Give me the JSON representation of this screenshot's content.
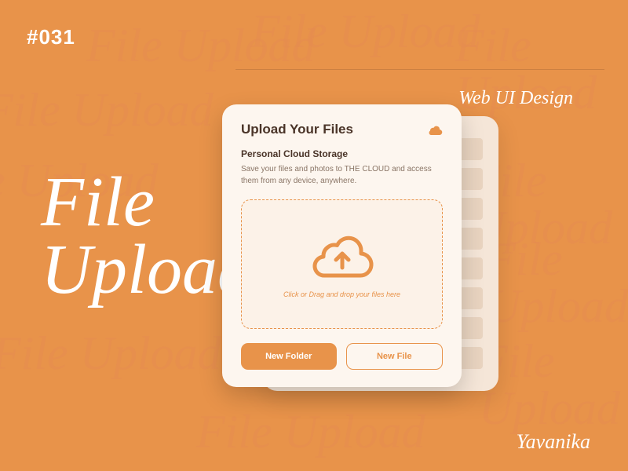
{
  "tag": "#031",
  "main_title_line1": "File",
  "main_title_line2": "Upload",
  "sub_label": "Web UI Design",
  "author": "Yavanika",
  "bg_word": "File Upload",
  "card": {
    "title": "Upload Your Files",
    "subtitle": "Personal Cloud Storage",
    "description": "Save your files and photos to THE CLOUD and access them from any device, anywhere.",
    "drop_hint": "Click or Drag and drop your files here",
    "btn_primary": "New Folder",
    "btn_secondary": "New File"
  }
}
